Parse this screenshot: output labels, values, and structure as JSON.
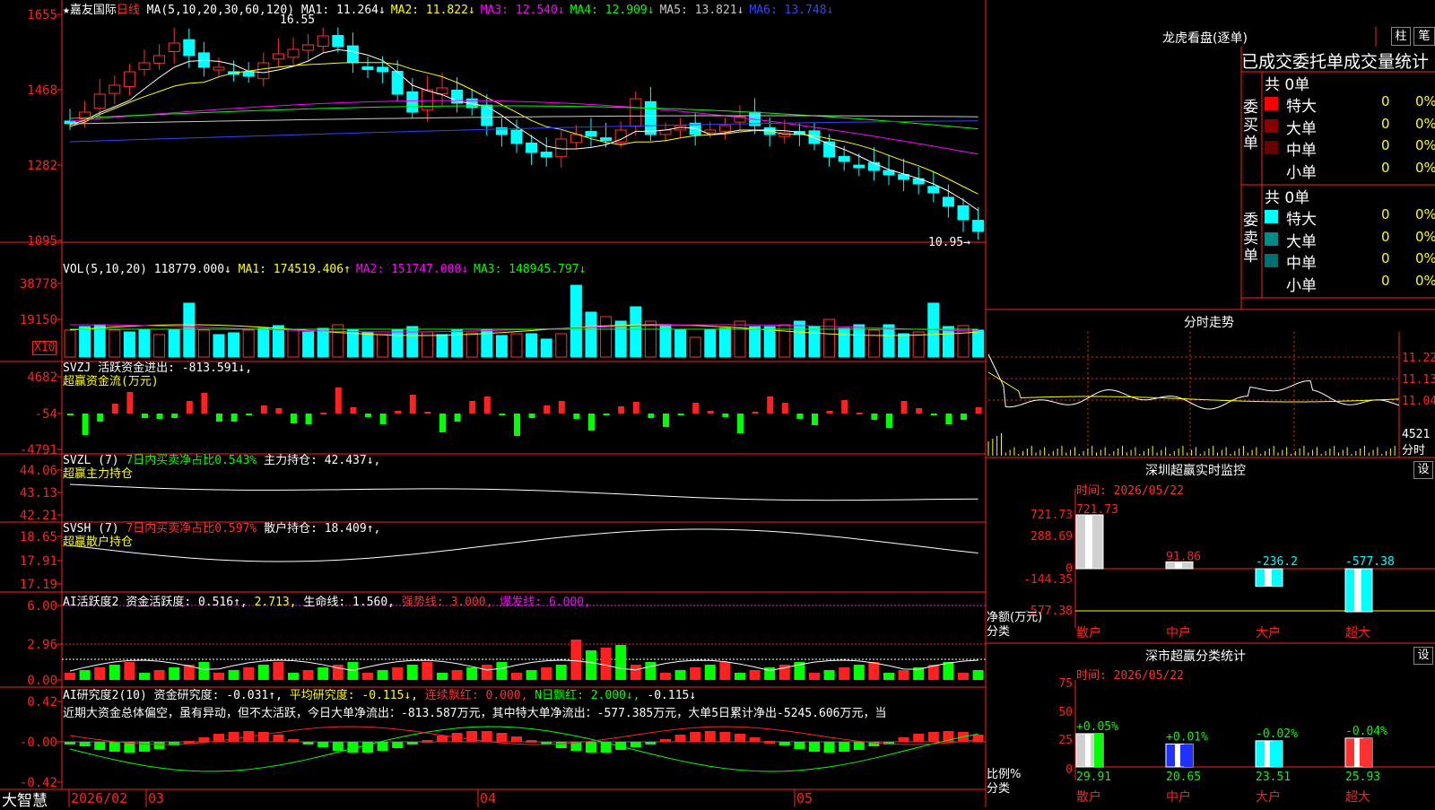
{
  "kline": {
    "stock_name": "★嘉友国际",
    "period": "日线",
    "ma_title": "MA(5,10,20,30,60,120)",
    "ma": [
      {
        "label": "MA1: 11.264↓",
        "color": "#ffffff"
      },
      {
        "label": "MA2: 11.822↓",
        "color": "#ffff00"
      },
      {
        "label": "MA3: 12.540↓",
        "color": "#ff00ff"
      },
      {
        "label": "MA4: 12.909↓",
        "color": "#00ff00"
      },
      {
        "label": "MA5: 13.821↓",
        "color": "#c8c8c8"
      },
      {
        "label": "MA6: 13.748↓",
        "color": "#3344ff"
      }
    ],
    "y_ticks": [
      "1655",
      "1468",
      "1282",
      "1095"
    ],
    "high_label": "16.55",
    "low_label": "10.95"
  },
  "vol": {
    "title": "VOL(5,10,20)",
    "value": "118779.000↓",
    "ma": [
      {
        "label": "MA1: 174519.406↑",
        "color": "#ffff00"
      },
      {
        "label": "MA2: 151747.000↓",
        "color": "#ff00ff"
      },
      {
        "label": "MA3: 148945.797↓",
        "color": "#00ff00"
      }
    ],
    "y_ticks": [
      "38778",
      "19150"
    ],
    "unit_label": "X10"
  },
  "svzj": {
    "title": "SVZJ",
    "line1": "活跃资金进出: -813.591↓,",
    "line2": "超赢资金流(万元)",
    "y_ticks": [
      "4682",
      "-54",
      "-4791"
    ]
  },
  "svzl": {
    "title": "SVZL (7)",
    "ratio": "7日内买卖净占比0.543%",
    "hold": "主力持仓: 42.437↓,",
    "line2": "超赢主力持仓",
    "y_ticks": [
      "44.06",
      "43.13",
      "42.21"
    ]
  },
  "svsh": {
    "title": "SVSH (7)",
    "ratio": "7日内买卖净占比0.597%",
    "hold": "散户持仓: 18.409↑,",
    "line2": "超赢散户持仓",
    "y_ticks": [
      "18.65",
      "17.91",
      "17.19"
    ]
  },
  "ai1": {
    "title": "AI活跃度2",
    "a": "资金活跃度: 0.516↑,",
    "b": "2.713,",
    "c": "生命线: 1.560,",
    "d": "强势线: 3.000,",
    "e": "爆发线: 6.000,",
    "y_ticks": [
      "6.00",
      "2.96",
      "0.00"
    ]
  },
  "ai2": {
    "title": "AI研究度2(10)",
    "a": "资金研究度: -0.031↑,",
    "b": "平均研究度: -0.115↓,",
    "c": "连续飘红: 0.000,",
    "d": "N日飘红: 2.000↓,",
    "e": "-0.115↓",
    "comment": "近期大资金总体偏空，虽有异动，但不太活跃，今日大单净流出：-813.587万元，其中特大单净流出：-577.385万元，大单5日累计净出-5245.606万元，当",
    "y_ticks": [
      "0.42",
      "-0.00",
      "-0.42"
    ]
  },
  "footer": {
    "brand": "大智慧",
    "dates": [
      "2026/02",
      "03",
      "04",
      "05"
    ]
  },
  "dragon": {
    "title": "龙虎看盘(逐单)",
    "btn1": "柱",
    "btn2": "笔",
    "tabs": "已成交委托单成交量统计",
    "buy_label": "委买单",
    "sell_label": "委卖单",
    "buy_total": "共 0单",
    "sell_total": "共 0单",
    "rows": [
      {
        "name": "特大",
        "count": "0",
        "pct": "0%"
      },
      {
        "name": "大单",
        "count": "0",
        "pct": "0%"
      },
      {
        "name": "中单",
        "count": "0",
        "pct": "0%"
      },
      {
        "name": "小单",
        "count": "0",
        "pct": "0%"
      }
    ]
  },
  "intraday": {
    "title": "分时走势",
    "y_ticks": [
      "11.22",
      "11.13",
      "11.04"
    ],
    "vol_tick": "4521",
    "unit": "分时"
  },
  "monitor": {
    "title": "深圳超赢实时监控",
    "btn": "设",
    "time": "时间: 2026/05/22",
    "y_ticks": [
      "721.73",
      "288.69",
      "0",
      "-144.35",
      "-577.38"
    ],
    "y_label": "净额(万元)",
    "x_label": "分类",
    "cats": [
      "散户",
      "中户",
      "大户",
      "超大"
    ],
    "values": [
      721.73,
      91.86,
      -236.2,
      -577.38
    ],
    "value_labels": [
      "721.73",
      "91.86",
      "-236.2",
      "-577.38"
    ]
  },
  "classify": {
    "title": "深市超赢分类统计",
    "btn": "设",
    "time": "时间: 2026/05/22",
    "y_ticks": [
      "75",
      "50",
      "25",
      "0"
    ],
    "y_label": "比例%",
    "x_label": "分类",
    "cats": [
      "散户",
      "中户",
      "大户",
      "超大"
    ],
    "values": [
      29.91,
      20.65,
      23.51,
      25.93
    ],
    "change_labels": [
      "+0.05%",
      "+0.01%",
      "-0.02%",
      "-0.04%"
    ]
  }
}
